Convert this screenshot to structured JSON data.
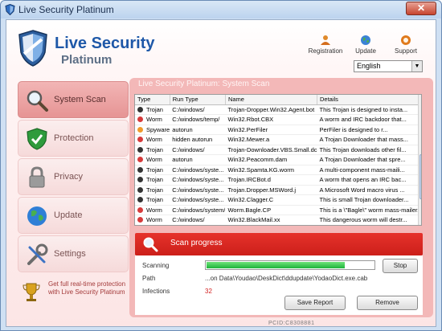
{
  "window": {
    "title": "Live Security Platinum",
    "close_label": "✕"
  },
  "header": {
    "logo_line1": "Live Security",
    "logo_line2": "Platinum",
    "buttons": [
      {
        "label": "Registration",
        "icon": "registration-icon"
      },
      {
        "label": "Update",
        "icon": "update-globe-icon"
      },
      {
        "label": "Support",
        "icon": "support-icon"
      }
    ],
    "language": {
      "selected": "English"
    }
  },
  "sidebar": {
    "items": [
      {
        "label": "System Scan",
        "icon": "magnifier-icon",
        "active": true
      },
      {
        "label": "Protection",
        "icon": "shield-check-icon",
        "active": false
      },
      {
        "label": "Privacy",
        "icon": "padlock-icon",
        "active": false
      },
      {
        "label": "Update",
        "icon": "globe-icon",
        "active": false
      },
      {
        "label": "Settings",
        "icon": "wrench-icon",
        "active": false
      }
    ],
    "promo": "Get full real-time protection with Live Security Platinum"
  },
  "main": {
    "title": "Live Security Platinum: System Scan",
    "columns": [
      "Type",
      "Run Type",
      "Name",
      "Details"
    ],
    "rows": [
      {
        "type": "Trojan",
        "run": "C:/windows/",
        "name": "Trojan-Dropper.Win32.Agent.bot",
        "details": "This Trojan is designed to insta...",
        "dot": "#333333"
      },
      {
        "type": "Worm",
        "run": "C:/windows/temp/",
        "name": "Win32.Rbot.CBX",
        "details": "A worm and IRC backdoor that...",
        "dot": "#d63a3a"
      },
      {
        "type": "Spyware",
        "run": "autorun",
        "name": "Win32.PerFiler",
        "details": "PerFiler is designed to r...",
        "dot": "#f09a2a"
      },
      {
        "type": "Worm",
        "run": "hidden autorun",
        "name": "Win32.Mewer.a",
        "details": "A Trojan Downloader that mass...",
        "dot": "#d63a3a"
      },
      {
        "type": "Trojan",
        "run": "C:/windows/",
        "name": "Trojan-Downloader.VBS.Small.dc",
        "details": "This Trojan downloads other fil...",
        "dot": "#333333"
      },
      {
        "type": "Worm",
        "run": "autorun",
        "name": "Win32.Peacomm.dam",
        "details": "A Trojan Downloader that spre...",
        "dot": "#d63a3a"
      },
      {
        "type": "Trojan",
        "run": "C:/windows/syste...",
        "name": "Win32.Spamta.KG.worm",
        "details": "A multi-component mass-maili...",
        "dot": "#333333"
      },
      {
        "type": "Trojan",
        "run": "C:/windows/syste...",
        "name": "Trojan.IRCBot.d",
        "details": "A worm that opens an IRC bac...",
        "dot": "#333333"
      },
      {
        "type": "Trojan",
        "run": "C:/windows/syste...",
        "name": "Trojan.Dropper.MSWord.j",
        "details": "A Microsoft Word macro virus ...",
        "dot": "#333333"
      },
      {
        "type": "Trojan",
        "run": "C:/windows/syste...",
        "name": "Win32.Clagger.C",
        "details": "This is small Trojan downloader...",
        "dot": "#333333"
      },
      {
        "type": "Worm",
        "run": "C:/windows/system/",
        "name": "Worm.Bagle.CP",
        "details": "This is a \\\"Bagle\\\" worm mass-mailer...",
        "dot": "#d63a3a"
      },
      {
        "type": "Worm",
        "run": "C:/windows/",
        "name": "Win32.BlackMail.xx",
        "details": "This dangerous worm will destr...",
        "dot": "#d63a3a"
      }
    ],
    "progress": {
      "header": "Scan progress",
      "scanning_label": "Scanning",
      "percent": 0.82,
      "stop_label": "Stop",
      "path_label": "Path",
      "path_value": "...on Data\\Youdao\\DeskDict\\ddupdate\\YodaoDict.exe.cab",
      "infections_label": "Infections",
      "infections_value": "32",
      "save_report_label": "Save Report",
      "remove_label": "Remove"
    },
    "pcid": "PCID:C8308881"
  }
}
